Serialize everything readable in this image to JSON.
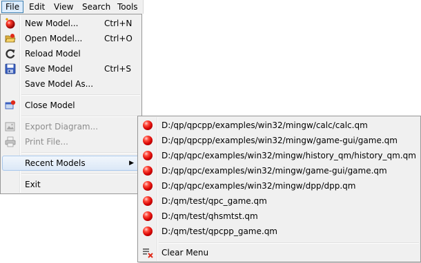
{
  "menubar": {
    "items": [
      {
        "label": "File"
      },
      {
        "label": "Edit"
      },
      {
        "label": "View"
      },
      {
        "label": "Search"
      },
      {
        "label": "Tools"
      }
    ]
  },
  "file_menu": {
    "new_model": {
      "label": "New Model...",
      "shortcut": "Ctrl+N"
    },
    "open_model": {
      "label": "Open Model...",
      "shortcut": "Ctrl+O"
    },
    "reload_model": {
      "label": "Reload Model"
    },
    "save_model": {
      "label": "Save Model",
      "shortcut": "Ctrl+S"
    },
    "save_model_as": {
      "label": "Save Model As..."
    },
    "close_model": {
      "label": "Close Model"
    },
    "export_diagram": {
      "label": "Export Diagram..."
    },
    "print_file": {
      "label": "Print File..."
    },
    "recent_models": {
      "label": "Recent Models",
      "arrow": "▶"
    },
    "exit": {
      "label": "Exit"
    }
  },
  "recent_models_menu": {
    "items": [
      {
        "path": "D:/qp/qpcpp/examples/win32/mingw/calc/calc.qm"
      },
      {
        "path": "D:/qp/qpcpp/examples/win32/mingw/game-gui/game.qm"
      },
      {
        "path": "D:/qp/qpc/examples/win32/mingw/history_qm/history_qm.qm"
      },
      {
        "path": "D:/qp/qpc/examples/win32/mingw/game-gui/game.qm"
      },
      {
        "path": "D:/qp/qpc/examples/win32/mingw/dpp/dpp.qm"
      },
      {
        "path": "D:/qm/test/qpc_game.qm"
      },
      {
        "path": "D:/qm/test/qhsmtst.qm"
      },
      {
        "path": "D:/qm/test/qpcpp_game.qm"
      }
    ],
    "clear_menu": {
      "label": "Clear Menu"
    }
  },
  "colors": {
    "menu_bg": "#f0f0f0",
    "highlight_border": "#a8c7ec",
    "disabled_text": "#8d8d8d",
    "model_ball": "#d40000"
  }
}
